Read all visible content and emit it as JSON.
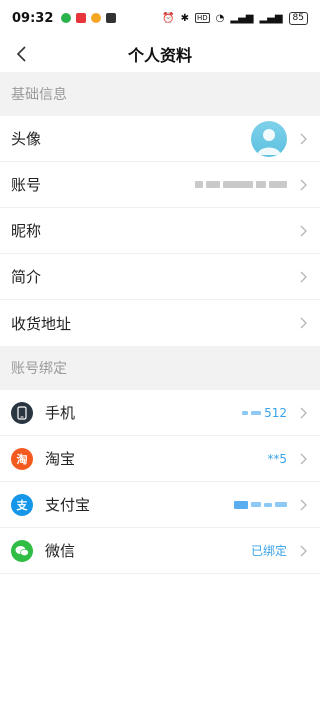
{
  "status_bar": {
    "time": "09:32",
    "battery": "85",
    "indicators": [
      "alarm-icon",
      "bluetooth-icon",
      "hd-icon",
      "wifi-icon",
      "signal-icon",
      "signal-icon"
    ]
  },
  "nav": {
    "title": "个人资料"
  },
  "sections": {
    "basic": "基础信息",
    "binding": "账号绑定"
  },
  "basic_rows": {
    "avatar": "头像",
    "account": "账号",
    "nickname": "昵称",
    "intro": "简介",
    "address": "收货地址"
  },
  "binding_rows": {
    "phone": {
      "label": "手机",
      "value": "512"
    },
    "taobao": {
      "label": "淘宝",
      "value": "**5"
    },
    "alipay": {
      "label": "支付宝",
      "value": ""
    },
    "wechat": {
      "label": "微信",
      "value": "已绑定"
    }
  },
  "colors": {
    "accent": "#3aa3e8",
    "section_bg": "#f2f2f2",
    "taobao": "#f35a1f",
    "alipay": "#1596e8",
    "wechat": "#2fbd45"
  }
}
